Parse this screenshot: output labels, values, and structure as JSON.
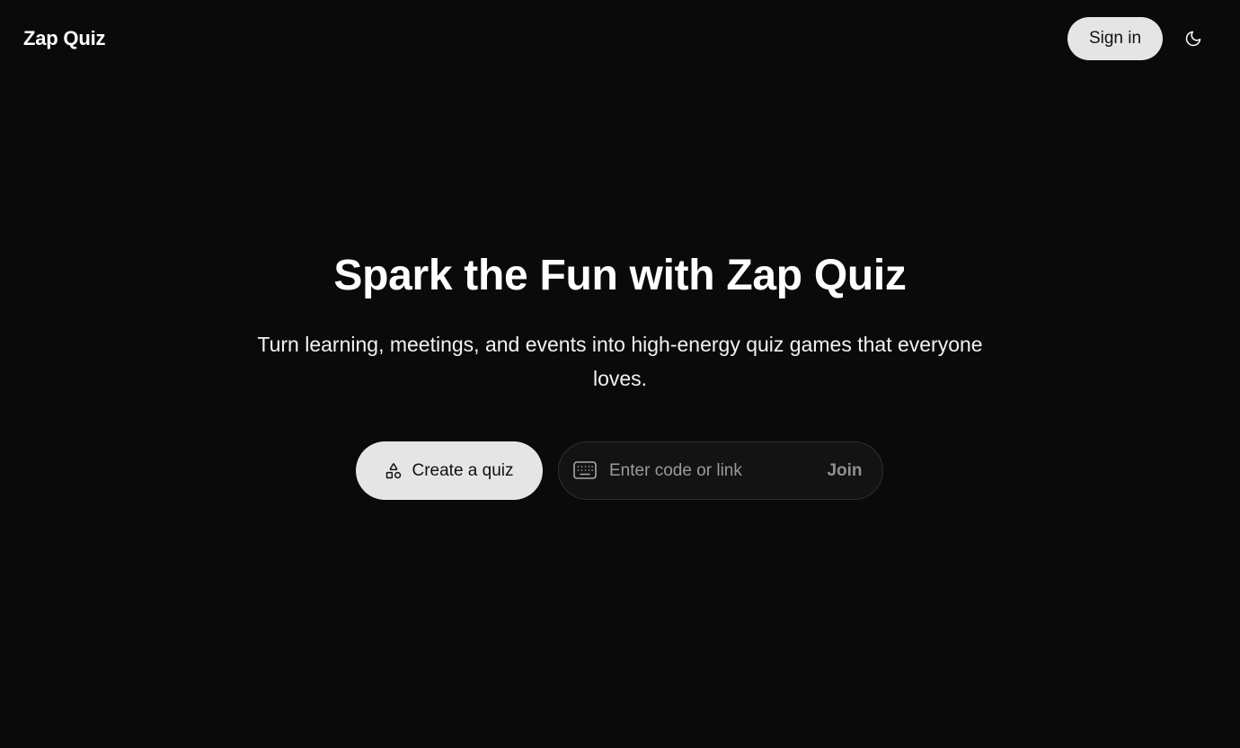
{
  "header": {
    "brand": "Zap Quiz",
    "signin_label": "Sign in",
    "theme_icon": "moon-icon"
  },
  "hero": {
    "headline": "Spark the Fun with Zap Quiz",
    "subline": "Turn learning, meetings, and events into high-energy quiz games that everyone loves."
  },
  "actions": {
    "create_label": "Create a quiz",
    "create_icon": "shapes-icon",
    "code_placeholder": "Enter code or link",
    "code_value": "",
    "code_icon": "keyboard-icon",
    "join_label": "Join"
  },
  "colors": {
    "background": "#0a0a0a",
    "button_light": "#e5e5e5",
    "input_bg": "#131313",
    "join_text": "#8f8f8f"
  }
}
